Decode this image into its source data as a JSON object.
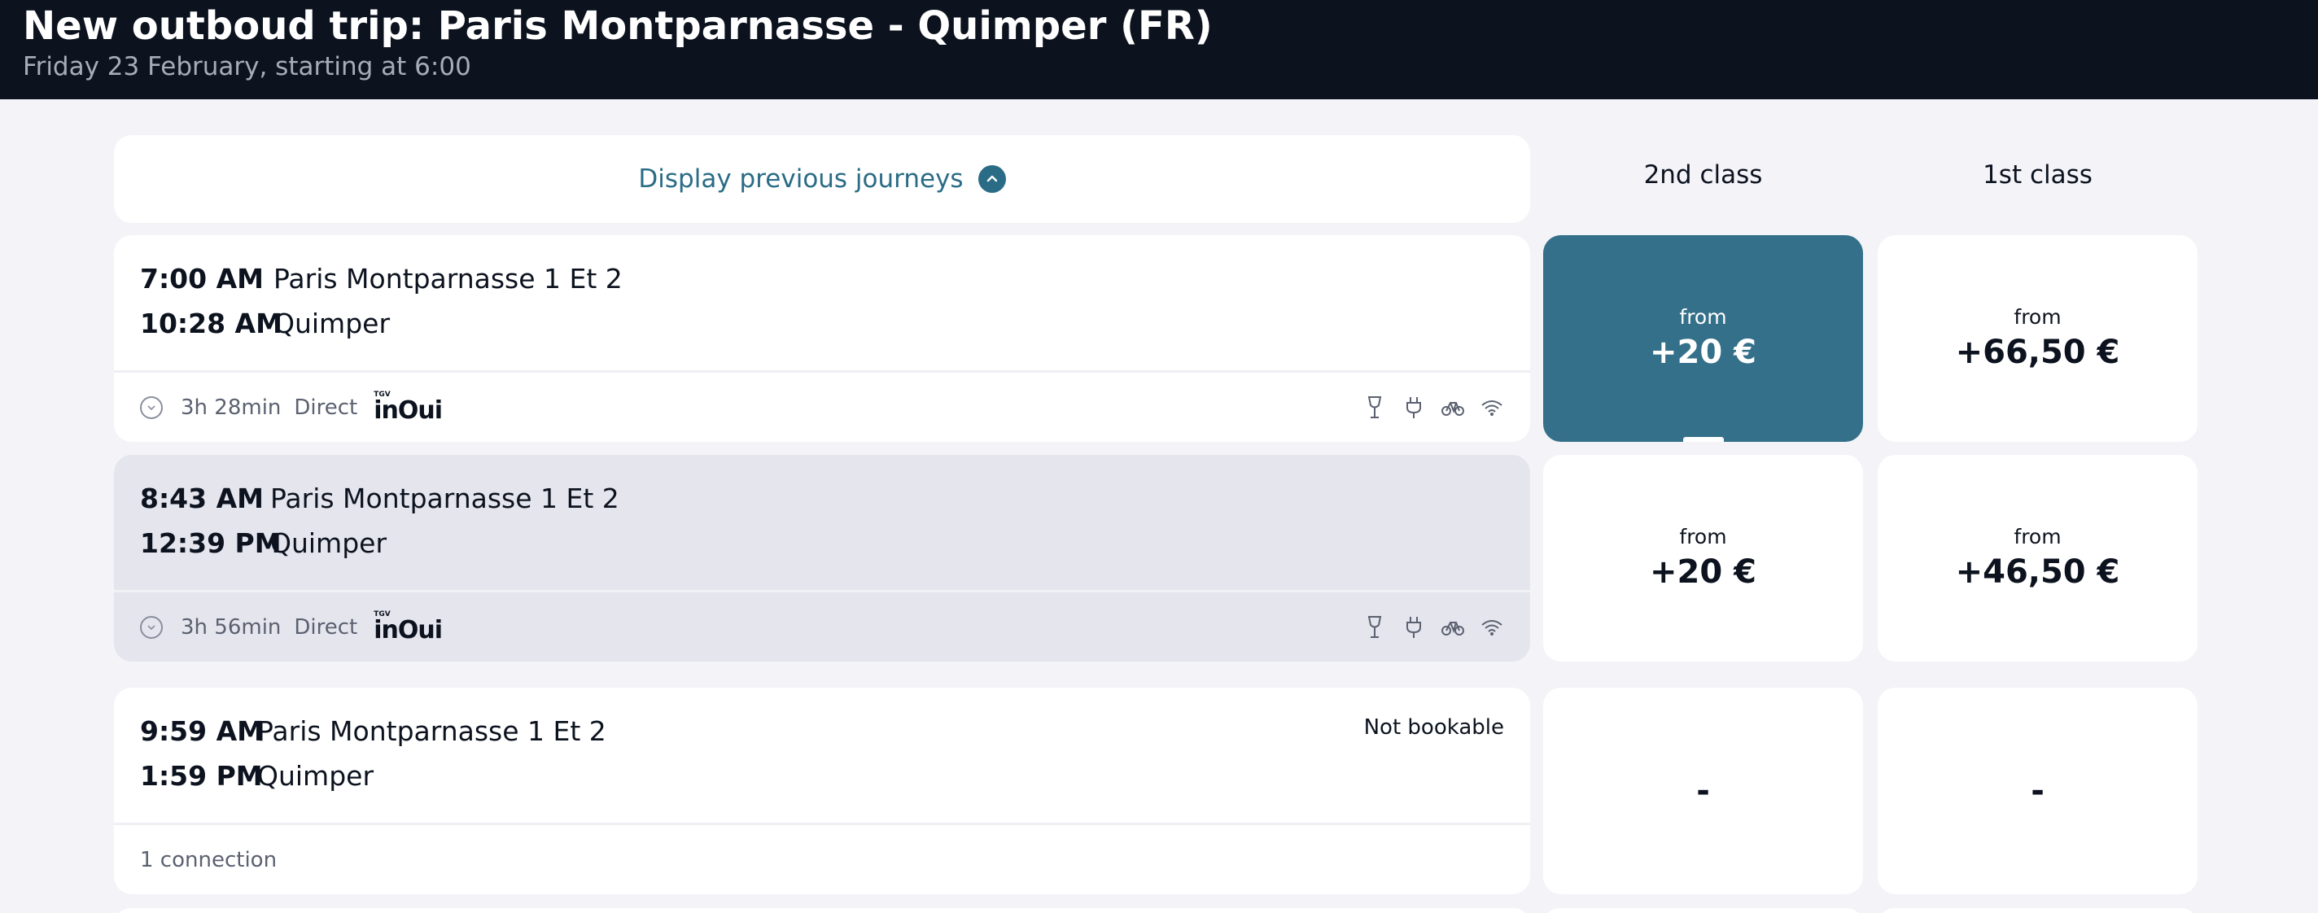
{
  "header": {
    "title": "New outboud trip: Paris Montparnasse - Quimper (FR)",
    "subtitle": "Friday 23 February, starting at 6:00"
  },
  "previous": {
    "label": "Display previous journeys",
    "icon": "chevron-up-icon"
  },
  "columns": {
    "second": "2nd class",
    "first": "1st class"
  },
  "journeys": [
    {
      "dep_time": "7:00 AM",
      "dep_station": "Paris Montparnasse 1 Et 2",
      "arr_time": "10:28 AM",
      "arr_station": "Quimper",
      "duration": "3h 28min",
      "type": "Direct",
      "brand_small": "TGV",
      "brand": "inOui",
      "amenities": [
        "bar-icon",
        "power-outlet-icon",
        "bicycle-icon",
        "wifi-icon"
      ],
      "second": {
        "from": "from",
        "price": "+20 €",
        "selected": true
      },
      "first": {
        "from": "from",
        "price": "+66,50 €"
      }
    },
    {
      "dep_time": "8:43 AM",
      "dep_station": "Paris Montparnasse 1 Et 2",
      "arr_time": "12:39 PM",
      "arr_station": "Quimper",
      "duration": "3h 56min",
      "type": "Direct",
      "brand_small": "TGV",
      "brand": "inOui",
      "amenities": [
        "bar-icon",
        "power-outlet-icon",
        "bicycle-icon",
        "wifi-icon"
      ],
      "second": {
        "from": "from",
        "price": "+20 €"
      },
      "first": {
        "from": "from",
        "price": "+46,50 €"
      }
    },
    {
      "dep_time": "9:59 AM",
      "dep_station": "Paris Montparnasse 1 Et 2",
      "arr_time": "1:59 PM",
      "arr_station": "Quimper",
      "status": "Not bookable",
      "connections": "1 connection",
      "second": {
        "price": "-"
      },
      "first": {
        "price": "-"
      }
    }
  ],
  "colors": {
    "header_bg": "#0c131f",
    "accent": "#2a6c86",
    "selected_price": "#35708b",
    "page_bg": "#f3f3f8"
  }
}
